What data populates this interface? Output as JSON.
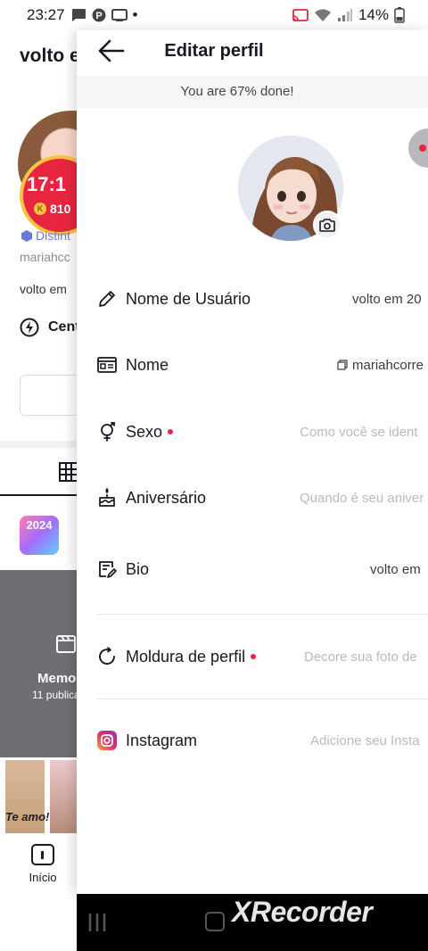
{
  "status_bar": {
    "time": "23:27",
    "dot": "•",
    "battery": "14%"
  },
  "background_profile": {
    "title": "volto e",
    "live_time": "17:1",
    "live_coins": "810",
    "coin_glyph": "K",
    "badge_text": "Distint",
    "username": "mariahcc",
    "bio": "volto em",
    "center_text": "Cent",
    "sticker_text": "2024",
    "grid_label": "Memo",
    "grid_sub": "11 publica",
    "thumb_text": "Te amo!",
    "home_label": "Início"
  },
  "panel": {
    "title": "Editar perfil",
    "progress_text": "You are 67% done!"
  },
  "fields": {
    "username": {
      "label": "Nome de Usuário",
      "value": "volto em 20"
    },
    "name": {
      "label": "Nome",
      "value": "mariahcorre"
    },
    "gender": {
      "label": "Sexo",
      "value": "Como você se ident"
    },
    "birthday": {
      "label": "Aniversário",
      "value": "Quando é seu aniver"
    },
    "bio": {
      "label": "Bio",
      "value": "volto em"
    },
    "frame": {
      "label": "Moldura de perfil",
      "value": "Decore sua foto de"
    },
    "instagram": {
      "label": "Instagram",
      "value": "Adicione seu Insta"
    }
  },
  "navbar": {
    "watermark": "XRecorder"
  },
  "colors": {
    "accent": "#e8253f",
    "placeholder": "#b9bac0"
  }
}
